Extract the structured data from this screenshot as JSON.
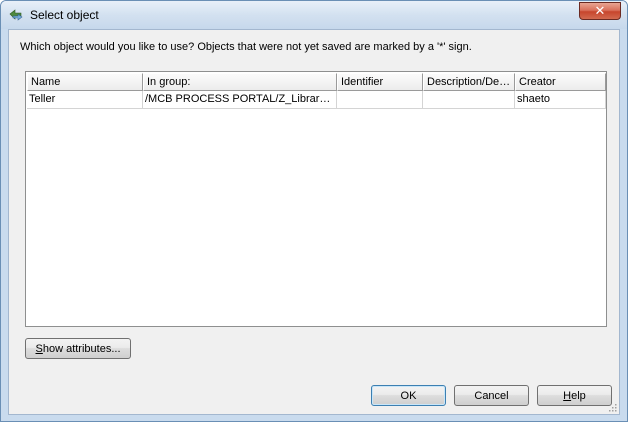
{
  "window": {
    "title": "Select object"
  },
  "prompt": "Which object would you like to use? Objects that were not yet saved are marked by a '*' sign.",
  "table": {
    "columns": [
      "Name",
      "In group:",
      "Identifier",
      "Description/Defi...",
      "Creator"
    ],
    "rows": [
      [
        "Teller",
        "/MCB PROCESS PORTAL/Z_Library/O...",
        "",
        "",
        "shaeto"
      ]
    ]
  },
  "buttons": {
    "show_attributes": {
      "mnemonic": "S",
      "rest": "how attributes..."
    },
    "ok": "OK",
    "cancel": "Cancel",
    "help": {
      "mnemonic": "H",
      "rest": "elp"
    }
  },
  "icons": {
    "title": "aris-app-icon",
    "close": "close-icon"
  },
  "colors": {
    "titlebar": "#c9dbee",
    "dialog_bg": "#f0f0f0",
    "close_red": "#c7452d",
    "default_button_border": "#3c7fb1"
  }
}
